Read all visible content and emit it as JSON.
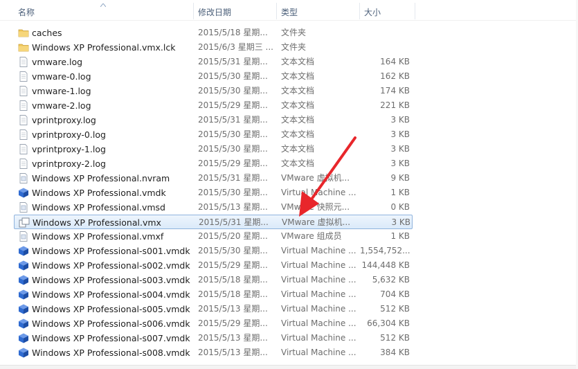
{
  "columns": {
    "name": "名称",
    "date": "修改日期",
    "type": "类型",
    "size": "大小"
  },
  "files": [
    {
      "name": "caches",
      "date": "2015/5/18 星期...",
      "type": "文件夹",
      "size": "",
      "icon": "folder-icon"
    },
    {
      "name": "Windows XP Professional.vmx.lck",
      "date": "2015/6/3 星期三 ...",
      "type": "文件夹",
      "size": "",
      "icon": "folder-icon"
    },
    {
      "name": "vmware.log",
      "date": "2015/5/31 星期...",
      "type": "文本文档",
      "size": "164 KB",
      "icon": "text-file-icon"
    },
    {
      "name": "vmware-0.log",
      "date": "2015/5/30 星期...",
      "type": "文本文档",
      "size": "162 KB",
      "icon": "text-file-icon"
    },
    {
      "name": "vmware-1.log",
      "date": "2015/5/30 星期...",
      "type": "文本文档",
      "size": "174 KB",
      "icon": "text-file-icon"
    },
    {
      "name": "vmware-2.log",
      "date": "2015/5/29 星期...",
      "type": "文本文档",
      "size": "221 KB",
      "icon": "text-file-icon"
    },
    {
      "name": "vprintproxy.log",
      "date": "2015/5/31 星期...",
      "type": "文本文档",
      "size": "3 KB",
      "icon": "text-file-icon"
    },
    {
      "name": "vprintproxy-0.log",
      "date": "2015/5/30 星期...",
      "type": "文本文档",
      "size": "3 KB",
      "icon": "text-file-icon"
    },
    {
      "name": "vprintproxy-1.log",
      "date": "2015/5/30 星期...",
      "type": "文本文档",
      "size": "3 KB",
      "icon": "text-file-icon"
    },
    {
      "name": "vprintproxy-2.log",
      "date": "2015/5/29 星期...",
      "type": "文本文档",
      "size": "3 KB",
      "icon": "text-file-icon"
    },
    {
      "name": "Windows XP Professional.nvram",
      "date": "2015/5/31 星期...",
      "type": "VMware 虚拟机...",
      "size": "9 KB",
      "icon": "vmware-file-icon"
    },
    {
      "name": "Windows XP Professional.vmdk",
      "date": "2015/5/30 星期...",
      "type": "Virtual Machine ...",
      "size": "1 KB",
      "icon": "disk-cube-icon"
    },
    {
      "name": "Windows XP Professional.vmsd",
      "date": "2015/5/13 星期...",
      "type": "VMware 快照元...",
      "size": "0 KB",
      "icon": "vmware-file-icon"
    },
    {
      "name": "Windows XP Professional.vmx",
      "date": "2015/5/31 星期...",
      "type": "VMware 虚拟机...",
      "size": "3 KB",
      "icon": "vm-config-icon",
      "selected": true
    },
    {
      "name": "Windows XP Professional.vmxf",
      "date": "2015/5/20 星期...",
      "type": "VMware 组成员",
      "size": "1 KB",
      "icon": "vmware-file-icon"
    },
    {
      "name": "Windows XP Professional-s001.vmdk",
      "date": "2015/5/30 星期...",
      "type": "Virtual Machine ...",
      "size": "1,554,752...",
      "icon": "disk-cube-icon"
    },
    {
      "name": "Windows XP Professional-s002.vmdk",
      "date": "2015/5/29 星期...",
      "type": "Virtual Machine ...",
      "size": "144,448 KB",
      "icon": "disk-cube-icon"
    },
    {
      "name": "Windows XP Professional-s003.vmdk",
      "date": "2015/5/18 星期...",
      "type": "Virtual Machine ...",
      "size": "5,632 KB",
      "icon": "disk-cube-icon"
    },
    {
      "name": "Windows XP Professional-s004.vmdk",
      "date": "2015/5/18 星期...",
      "type": "Virtual Machine ...",
      "size": "704 KB",
      "icon": "disk-cube-icon"
    },
    {
      "name": "Windows XP Professional-s005.vmdk",
      "date": "2015/5/13 星期...",
      "type": "Virtual Machine ...",
      "size": "512 KB",
      "icon": "disk-cube-icon"
    },
    {
      "name": "Windows XP Professional-s006.vmdk",
      "date": "2015/5/29 星期...",
      "type": "Virtual Machine ...",
      "size": "66,304 KB",
      "icon": "disk-cube-icon"
    },
    {
      "name": "Windows XP Professional-s007.vmdk",
      "date": "2015/5/13 星期...",
      "type": "Virtual Machine ...",
      "size": "512 KB",
      "icon": "disk-cube-icon"
    },
    {
      "name": "Windows XP Professional-s008.vmdk",
      "date": "2015/5/13 星期...",
      "type": "Virtual Machine ...",
      "size": "384 KB",
      "icon": "disk-cube-icon"
    }
  ],
  "colors": {
    "accent_arrow": "#e8262b",
    "selection_border": "#8fb3dd",
    "folder": "#f0c75a",
    "cube": "#2f6bd1"
  }
}
